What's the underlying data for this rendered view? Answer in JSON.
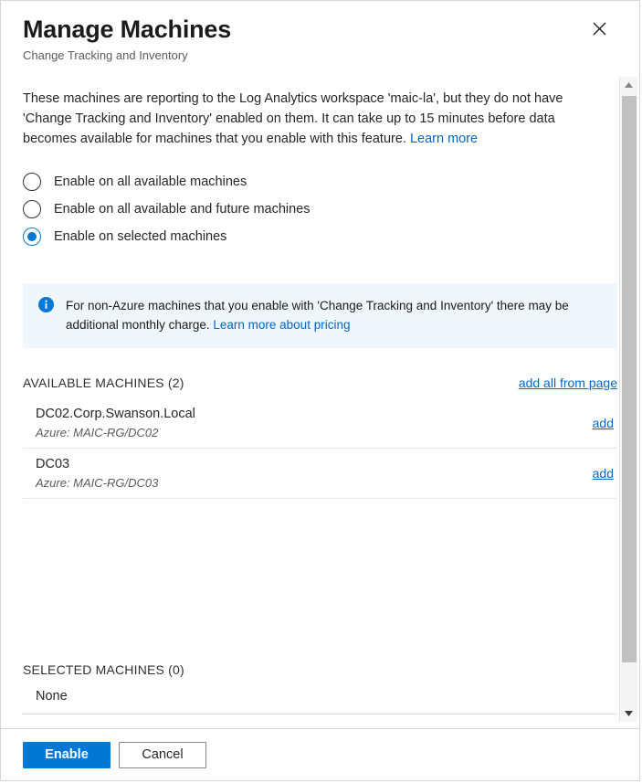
{
  "dialog": {
    "title": "Manage Machines",
    "subtitle": "Change Tracking and Inventory",
    "close_label": "×"
  },
  "intro": {
    "text": "These machines are reporting to the Log Analytics workspace 'maic-la', but they do not have 'Change Tracking and Inventory' enabled on them. It can take up to 15 minutes before data becomes available for machines that you enable with this feature.",
    "link_label": "Learn more"
  },
  "radio_options": [
    {
      "label": "Enable on all available machines",
      "selected": false
    },
    {
      "label": "Enable on all available and future machines",
      "selected": false
    },
    {
      "label": "Enable on selected machines",
      "selected": true
    }
  ],
  "info_banner": {
    "icon": "info-icon",
    "text": "For non-Azure machines that you enable with 'Change Tracking and Inventory' there may be additional monthly charge.",
    "link_label": "Learn more about pricing",
    "background_color": "#eff6fc",
    "icon_color": "#0078d4"
  },
  "available": {
    "section_title": "AVAILABLE MACHINES (2)",
    "count": 2,
    "add_all_label": "add all from page",
    "machines": [
      {
        "name": "DC02.Corp.Swanson.Local",
        "detail": "Azure: MAIC-RG/DC02",
        "action_label": "add"
      },
      {
        "name": "DC03",
        "detail": "Azure: MAIC-RG/DC03",
        "action_label": "add"
      }
    ]
  },
  "selected": {
    "section_title": "SELECTED MACHINES (0)",
    "count": 0,
    "empty_label": "None"
  },
  "footer": {
    "primary_label": "Enable",
    "secondary_label": "Cancel",
    "primary_color": "#0078d4"
  },
  "scrollbar": {
    "up_arrow": "▲",
    "down_arrow": "▼"
  }
}
